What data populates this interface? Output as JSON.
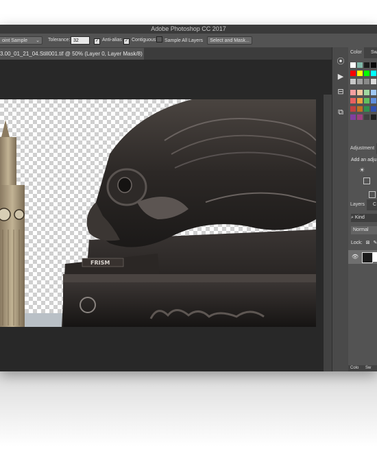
{
  "app": {
    "title": "Adobe Photoshop CC 2017"
  },
  "options_bar": {
    "sample_select": "oint Sample",
    "tolerance_label": "Tolerance:",
    "tolerance_value": "32",
    "anti_alias": {
      "label": "Anti-alias",
      "checked": true
    },
    "contiguous": {
      "label": "Contiguous",
      "checked": true
    },
    "sample_all_layers": {
      "label": "Sample All Layers",
      "checked": false
    },
    "select_mask_button": "Select and Mask..."
  },
  "document_tab": {
    "title": "3.00_01_21_04.Still001.tif @ 50% (Layer 0, Layer Mask/8) *"
  },
  "canvas": {
    "statue_plaque_text": "FRISM"
  },
  "panels": {
    "color_tabs": [
      "Color",
      "Sw"
    ],
    "adjustments": {
      "title": "Adjustment",
      "add_text": "Add an adju"
    },
    "layers": {
      "tabs": [
        "Layers",
        "C"
      ],
      "kind_label": "Kind",
      "blend_mode": "Normal",
      "lock_label": "Lock:"
    },
    "bottom_tabs": [
      "Colo",
      "Sw"
    ]
  },
  "icons": {
    "panel_strip": [
      "color-panel-icon",
      "play-action-icon",
      "adjust-panel-icon",
      "layers-panel-icon"
    ],
    "kind_search": "search-icon",
    "layer_visibility": "eye-icon"
  },
  "colors": {
    "workspace": "#535353",
    "canvas_bg": "#282828",
    "swatches_row1": [
      "#ffffff",
      "#7fb7a8",
      "#1a1a1a",
      "#0a0a0a"
    ],
    "swatches_row2": [
      "#ff0000",
      "#ffff00",
      "#00ff00",
      "#00ffff"
    ],
    "swatches_row3": [
      "#c8c8c8",
      "#a0a0a0",
      "#8a8a8a",
      "#dcdcdc"
    ],
    "swatches_row4": [
      "#f4a0a0",
      "#f4c8a0",
      "#a0d8a0",
      "#a0c8f4"
    ],
    "swatches_row5": [
      "#e86060",
      "#f0a040",
      "#60c060",
      "#6090e0"
    ],
    "swatches_row6": [
      "#c04040",
      "#c07020",
      "#309050",
      "#3050b0"
    ],
    "swatches_row7": [
      "#8040a0",
      "#a04080",
      "#404040",
      "#202020"
    ]
  }
}
